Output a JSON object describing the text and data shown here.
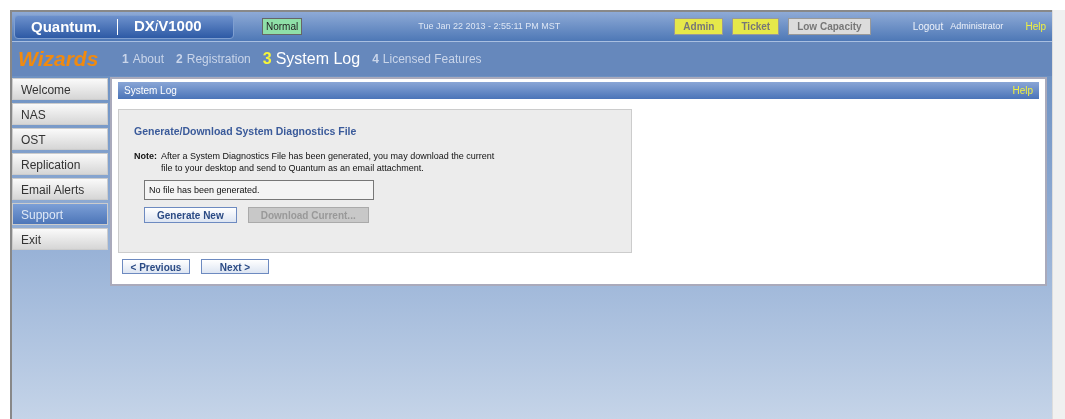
{
  "header": {
    "brand": "Quantum.",
    "product": {
      "prefix": "DX",
      "italic": "i",
      "model": "V1000"
    },
    "status": "Normal",
    "datetime": "Tue Jan 22 2013 - 2:55:11 PM MST",
    "badges": [
      {
        "label": "Admin",
        "color": "#e6e84a"
      },
      {
        "label": "Ticket",
        "color": "#e6e84a"
      },
      {
        "label": "Low Capacity",
        "color": "#dcdcdc"
      }
    ],
    "logout": "Logout",
    "user": "Administrator",
    "help": "Help"
  },
  "wizard": {
    "title": "Wizards",
    "steps": [
      {
        "number": "1",
        "label": "About",
        "selected": false
      },
      {
        "number": "2",
        "label": "Registration",
        "selected": false
      },
      {
        "number": "3",
        "label": "System Log",
        "selected": true
      },
      {
        "number": "4",
        "label": "Licensed Features",
        "selected": false
      }
    ]
  },
  "sidebar": {
    "items": [
      {
        "label": "Welcome",
        "selected": false
      },
      {
        "label": "NAS",
        "selected": false
      },
      {
        "label": "OST",
        "selected": false
      },
      {
        "label": "Replication",
        "selected": false
      },
      {
        "label": "Email Alerts",
        "selected": false
      },
      {
        "label": "Support",
        "selected": true
      },
      {
        "label": "Exit",
        "selected": false
      }
    ]
  },
  "panel": {
    "title": "System Log",
    "help": "Help",
    "section_title": "Generate/Download System Diagnostics File",
    "note_label": "Note:",
    "note": [
      "After a System Diagnostics File has been generated, you may download the current",
      "file to your desktop and send to Quantum as an email attachment."
    ],
    "file_status": "No file has been generated.",
    "buttons": [
      {
        "label": "Generate New",
        "disabled": false
      },
      {
        "label": "Download Current...",
        "disabled": true
      }
    ],
    "nav": [
      {
        "label": "< Previous"
      },
      {
        "label": "Next >"
      }
    ]
  }
}
